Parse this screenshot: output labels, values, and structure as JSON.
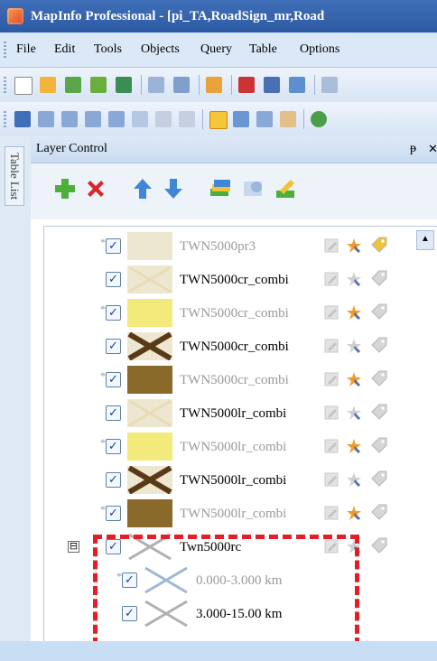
{
  "window": {
    "title": "MapInfo Professional - [pi_TA,RoadSign_mr,Road"
  },
  "menu": [
    "File",
    "Edit",
    "Tools",
    "Objects",
    "Query",
    "Table",
    "Options"
  ],
  "side_tab": {
    "label": "Table List"
  },
  "panel": {
    "title": "Layer Control",
    "pin_glyph": "ᵽ",
    "close_glyph": "✕",
    "tools": [
      "add-layer",
      "remove-layer",
      "move-up",
      "move-down",
      "layer-properties",
      "reorder",
      "label-settings"
    ]
  },
  "colors": {
    "title_bar": "#2d5aa3",
    "cream": "#ede6d1",
    "yellow": "#f2ea7a",
    "brown": "#8a6a2b",
    "highlight": "#e41e26"
  },
  "layers": [
    {
      "name": "TWN5000pr3",
      "dim": true,
      "star": true,
      "checked": true,
      "swatch": "cream",
      "swatch_x": "none",
      "label_on": true
    },
    {
      "name": "TWN5000cr_combi",
      "dim": false,
      "star": false,
      "checked": true,
      "swatch": "cream",
      "swatch_x": "light",
      "label_on": false
    },
    {
      "name": "TWN5000cr_combi",
      "dim": true,
      "star": true,
      "checked": true,
      "swatch": "yellow",
      "swatch_x": "none",
      "label_on": false
    },
    {
      "name": "TWN5000cr_combi",
      "dim": false,
      "star": false,
      "checked": true,
      "swatch": "cream",
      "swatch_x": "dark",
      "label_on": false
    },
    {
      "name": "TWN5000cr_combi",
      "dim": true,
      "star": true,
      "checked": true,
      "swatch": "brown",
      "swatch_x": "none",
      "label_on": false
    },
    {
      "name": "TWN5000lr_combi",
      "dim": false,
      "star": false,
      "checked": true,
      "swatch": "cream",
      "swatch_x": "light",
      "label_on": false
    },
    {
      "name": "TWN5000lr_combi",
      "dim": true,
      "star": true,
      "checked": true,
      "swatch": "yellow",
      "swatch_x": "none",
      "label_on": false
    },
    {
      "name": "TWN5000lr_combi",
      "dim": false,
      "star": false,
      "checked": true,
      "swatch": "cream",
      "swatch_x": "dark",
      "label_on": false
    },
    {
      "name": "TWN5000lr_combi",
      "dim": true,
      "star": true,
      "checked": true,
      "swatch": "brown",
      "swatch_x": "none",
      "label_on": false
    },
    {
      "name": "Twn5000rc",
      "dim": false,
      "star": false,
      "checked": true,
      "swatch": "grid",
      "swatch_x": "grey",
      "label_on": false,
      "expander": "⊟"
    },
    {
      "name": "0.000-3.000 km",
      "dim": true,
      "star": true,
      "checked": true,
      "swatch": "grid",
      "swatch_x": "blue",
      "label_on": false,
      "indent": true
    },
    {
      "name": "3.000-15.00 km",
      "dim": false,
      "star": false,
      "checked": true,
      "swatch": "grid",
      "swatch_x": "grey",
      "label_on": false,
      "indent": true
    }
  ]
}
